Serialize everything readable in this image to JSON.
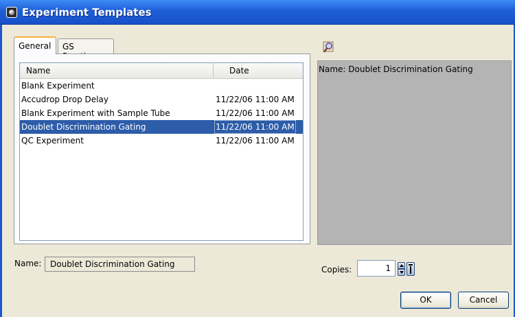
{
  "window": {
    "title": "Experiment Templates"
  },
  "tabs": [
    {
      "label": "General",
      "active": true
    },
    {
      "label": "GS Practice",
      "active": false
    }
  ],
  "table": {
    "columns": [
      "Name",
      "Date"
    ],
    "rows": [
      {
        "name": "Blank Experiment",
        "date": ""
      },
      {
        "name": "Accudrop Drop Delay",
        "date": "11/22/06 11:00 AM"
      },
      {
        "name": "Blank Experiment with Sample Tube",
        "date": "11/22/06 11:00 AM"
      },
      {
        "name": "Doublet Discrimination Gating",
        "date": "11/22/06 11:00 AM",
        "selected": true
      },
      {
        "name": "QC Experiment",
        "date": "11/22/06 11:00 AM"
      }
    ]
  },
  "name_field": {
    "label": "Name:",
    "value": "Doublet Discrimination Gating"
  },
  "preview": {
    "text": "Name: Doublet Discrimination Gating",
    "zoom_icon": "magnifier-icon"
  },
  "copies": {
    "label": "Copies:",
    "value": "1"
  },
  "buttons": {
    "ok": "OK",
    "cancel": "Cancel"
  },
  "colors": {
    "title_bar": "#1f5fd8",
    "selection": "#2d5ca8",
    "preview_bg": "#b4b4b4"
  }
}
